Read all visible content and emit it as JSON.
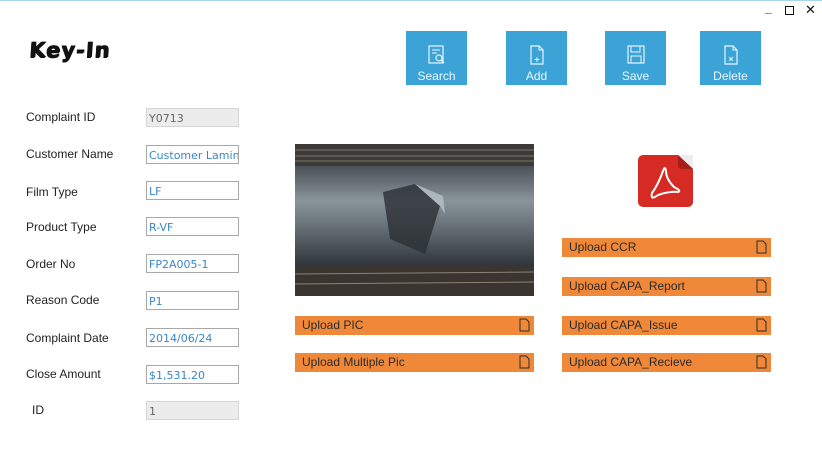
{
  "window": {
    "min_icon": "minimize-icon",
    "max_icon": "maximize-icon",
    "close_label": "✕"
  },
  "app": {
    "logo_text": "Key-In"
  },
  "toolbar": {
    "accent": "#3ba3d6",
    "search_label": "Search",
    "add_label": "Add",
    "save_label": "Save",
    "delete_label": "Delete"
  },
  "form": {
    "complaint_id": {
      "label": "Complaint ID",
      "value": "Y0713"
    },
    "customer_name": {
      "label": "Customer Name",
      "value": "Customer Lamina"
    },
    "film_type": {
      "label": "Film Type",
      "value": "LF"
    },
    "product_type": {
      "label": "Product Type",
      "value": "R-VF"
    },
    "order_no": {
      "label": "Order No",
      "value": "FP2A005-1"
    },
    "reason_code": {
      "label": "Reason Code",
      "value": "P1"
    },
    "complaint_date": {
      "label": "Complaint Date",
      "value": "2014/06/24"
    },
    "close_amount": {
      "label": "Close Amount",
      "value": "$1,531.20"
    },
    "id": {
      "label": "ID",
      "value": "1"
    }
  },
  "uploads": {
    "accent": "#f0883a",
    "pic": "Upload PIC",
    "multiple_pic": "Upload Multiple Pic",
    "ccr": "Upload CCR",
    "capa_report": "Upload CAPA_Report",
    "capa_issue": "Upload CAPA_Issue",
    "capa_recieve": "Upload CAPA_Recieve"
  },
  "icons": {
    "pdf": "pdf-icon",
    "document": "document-icon"
  }
}
